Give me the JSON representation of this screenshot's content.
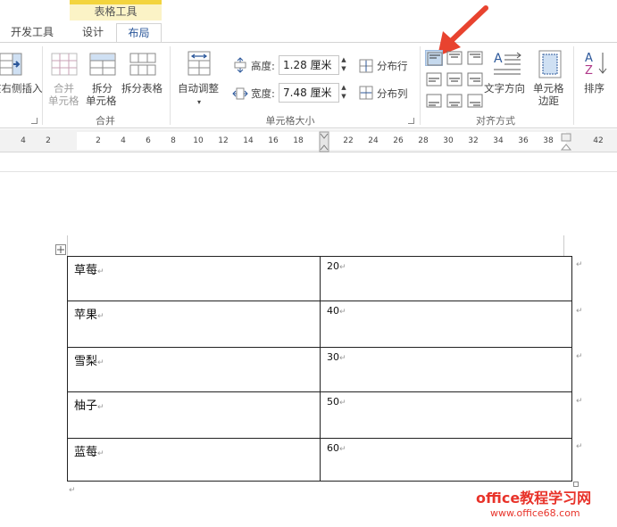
{
  "ribbon_tabs": {
    "context_title": "表格工具",
    "developer": "开发工具",
    "design": "设计",
    "layout": "布局"
  },
  "rows_columns_group": {
    "insert_right": "在右侧插入"
  },
  "merge_group": {
    "label": "合并",
    "merge_cells_line1": "合并",
    "merge_cells_line2": "单元格",
    "split_cells_line1": "拆分",
    "split_cells_line2": "单元格",
    "split_table": "拆分表格"
  },
  "cell_size_group": {
    "label": "单元格大小",
    "autofit": "自动调整",
    "height_label": "高度:",
    "height_value": "1.28 厘米",
    "width_label": "宽度:",
    "width_value": "7.48 厘米",
    "distribute_rows": "分布行",
    "distribute_cols": "分布列"
  },
  "alignment_group": {
    "label": "对齐方式",
    "text_direction": "文字方向",
    "cell_margins_line1": "单元格",
    "cell_margins_line2": "边距"
  },
  "data_group": {
    "sort": "排序"
  },
  "ruler": {
    "ticks": [
      "4",
      "2",
      "2",
      "4",
      "6",
      "8",
      "10",
      "12",
      "14",
      "16",
      "18",
      "22",
      "24",
      "26",
      "28",
      "30",
      "32",
      "34",
      "36",
      "38",
      "42"
    ]
  },
  "table": {
    "rows": [
      {
        "name": "草莓",
        "value": "20"
      },
      {
        "name": "苹果",
        "value": "40"
      },
      {
        "name": "雪梨",
        "value": "30"
      },
      {
        "name": "柚子",
        "value": "50"
      },
      {
        "name": "蓝莓",
        "value": "60"
      }
    ]
  },
  "watermark": {
    "line1": "office教程学习网",
    "line2": "www.office68.com"
  },
  "colors": {
    "accent": "#2b579a",
    "context_band": "#f3d43e",
    "arrow": "#e8432f",
    "selected_align": "#c5d9ee"
  }
}
